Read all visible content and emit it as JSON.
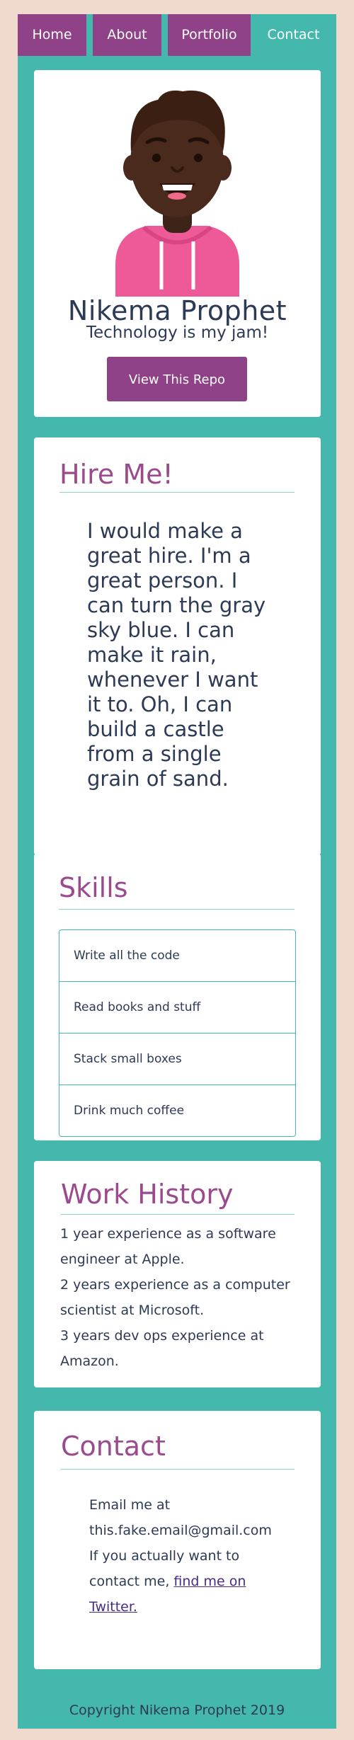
{
  "nav": {
    "items": [
      {
        "label": "Home"
      },
      {
        "label": "About"
      },
      {
        "label": "Portfolio"
      },
      {
        "label": "Contact"
      }
    ]
  },
  "profile": {
    "name": "Nikema Prophet",
    "tagline": "Technology is my jam!",
    "button_label": "View This Repo"
  },
  "hire": {
    "title": "Hire Me!",
    "text": "I would make a great hire. I'm a great person. I can turn the gray sky blue. I can make it rain, whenever I want it to. Oh, I can build a castle from a single grain of sand."
  },
  "skills": {
    "title": "Skills",
    "items": [
      "Write all the code",
      "Read books and stuff",
      "Stack small boxes",
      "Drink much coffee"
    ]
  },
  "work": {
    "title": "Work History",
    "lines": [
      "1 year experience as a software engineer at Apple.",
      "2 years experience as a computer scientist at Microsoft.",
      "3 years dev ops experience at Amazon."
    ]
  },
  "contact": {
    "title": "Contact",
    "email_line": "Email me at this.fake.email@gmail.com",
    "twitter_prefix": "If you actually want to contact me, ",
    "twitter_link": "find me on Twitter."
  },
  "footer": {
    "text": "Copyright Nikema Prophet 2019"
  },
  "colors": {
    "background": "#f0d9cd",
    "frame": "#45b8ae",
    "accent": "#8f4287",
    "title": "#9b4a8e"
  }
}
